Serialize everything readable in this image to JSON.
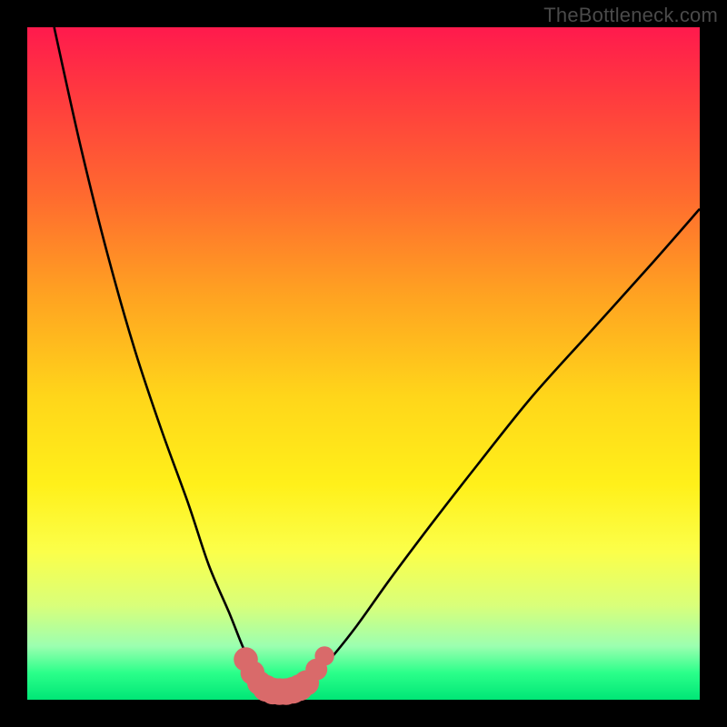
{
  "watermark": "TheBottleneck.com",
  "colors": {
    "frame": "#000000",
    "curve_stroke": "#000000",
    "marker_fill": "#d96a6a",
    "marker_stroke": "#c95858"
  },
  "chart_data": {
    "type": "line",
    "title": "",
    "xlabel": "",
    "ylabel": "",
    "xlim": [
      0,
      100
    ],
    "ylim": [
      0,
      100
    ],
    "grid": false,
    "note": "Decorative bottleneck V-curve. Axes & scales are not labeled in the source image; x/y values below are estimated in percent of plot width/height (origin top-left of gradient area).",
    "series": [
      {
        "name": "bottleneck-curve-left",
        "x": [
          4,
          8,
          12,
          16,
          20,
          24,
          27,
          30,
          32,
          33.5,
          35,
          36.5,
          38
        ],
        "y": [
          0,
          18,
          34,
          48,
          60,
          71,
          80,
          87,
          92,
          95,
          97,
          98,
          98.5
        ]
      },
      {
        "name": "bottleneck-curve-right",
        "x": [
          38,
          40,
          42,
          45,
          49,
          54,
          60,
          67,
          75,
          84,
          93,
          100
        ],
        "y": [
          98.5,
          98,
          97,
          94,
          89,
          82,
          74,
          65,
          55,
          45,
          35,
          27
        ]
      }
    ],
    "markers": {
      "name": "highlight-dots",
      "note": "Salmon-colored dots near the trough of the curve",
      "points": [
        {
          "x": 32.5,
          "y": 94,
          "r": 1.4
        },
        {
          "x": 33.5,
          "y": 96,
          "r": 1.4
        },
        {
          "x": 34.5,
          "y": 97.5,
          "r": 1.4
        },
        {
          "x": 35.5,
          "y": 98.3,
          "r": 1.6
        },
        {
          "x": 36.5,
          "y": 98.7,
          "r": 1.6
        },
        {
          "x": 37.5,
          "y": 98.8,
          "r": 1.6
        },
        {
          "x": 38.5,
          "y": 98.8,
          "r": 1.6
        },
        {
          "x": 39.5,
          "y": 98.6,
          "r": 1.6
        },
        {
          "x": 40.5,
          "y": 98.2,
          "r": 1.6
        },
        {
          "x": 41.5,
          "y": 97.5,
          "r": 1.5
        },
        {
          "x": 43.0,
          "y": 95.5,
          "r": 1.2
        },
        {
          "x": 44.2,
          "y": 93.5,
          "r": 1.0
        }
      ]
    }
  }
}
